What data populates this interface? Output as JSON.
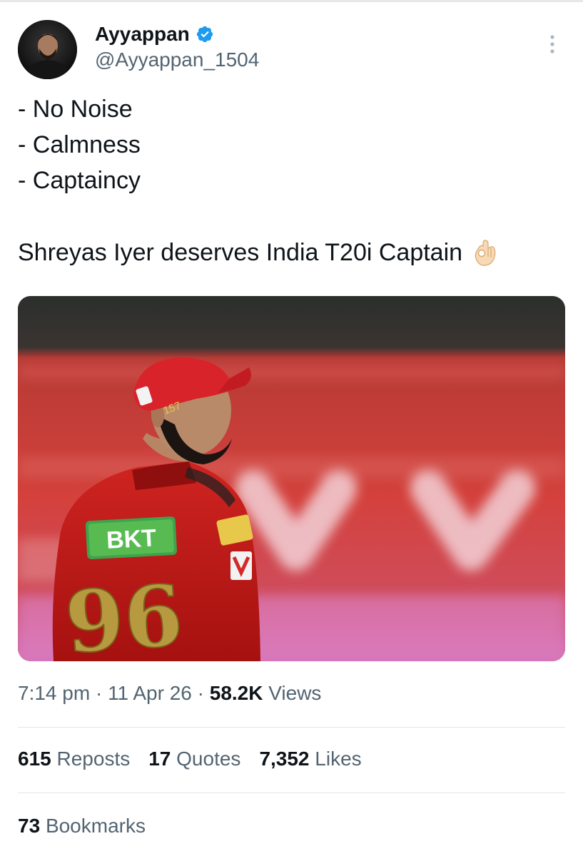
{
  "author": {
    "display_name": "Ayyappan",
    "handle": "@Ayyappan_1504",
    "verified": true,
    "verified_color": "#1d9bf0"
  },
  "tweet": {
    "lines": [
      "- No Noise",
      "- Calmness",
      "- Captaincy"
    ],
    "statement": "Shreyas Iyer deserves India T20i Captain",
    "emoji": "ok-hand-emoji"
  },
  "media": {
    "jersey_sponsor": "BKT",
    "jersey_number": "96",
    "cap_number": "157"
  },
  "meta": {
    "time": "7:14 pm",
    "separator": "·",
    "date": "11 Apr 26",
    "views_count": "58.2K",
    "views_label": "Views"
  },
  "stats": {
    "reposts_count": "615",
    "reposts_label": "Reposts",
    "quotes_count": "17",
    "quotes_label": "Quotes",
    "likes_count": "7,352",
    "likes_label": "Likes",
    "bookmarks_count": "73",
    "bookmarks_label": "Bookmarks"
  }
}
